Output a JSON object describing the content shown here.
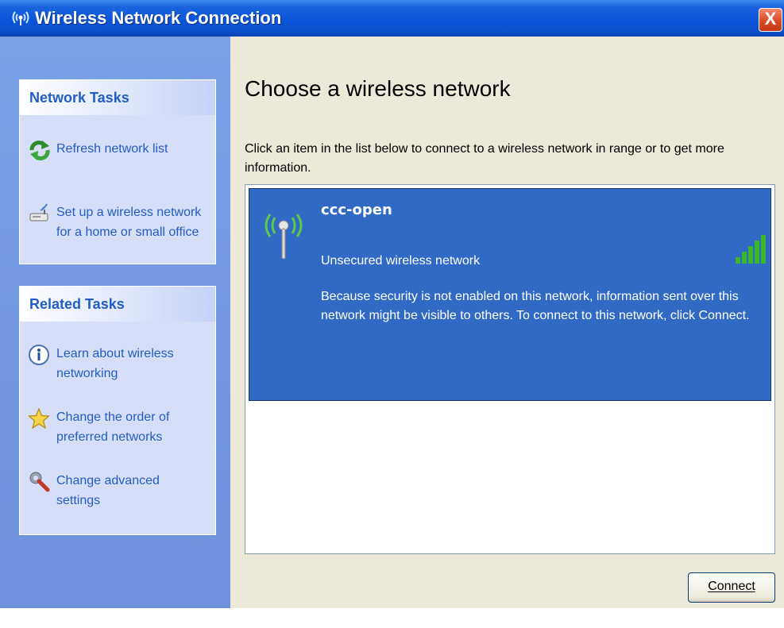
{
  "window": {
    "title": "Wireless Network Connection",
    "close_label": "X"
  },
  "sidebar": {
    "network_tasks": {
      "title": "Network Tasks",
      "items": [
        {
          "label": "Refresh network list",
          "icon": "refresh-icon"
        },
        {
          "label": "Set up a wireless network for a home or small office",
          "icon": "setup-wireless-icon"
        }
      ]
    },
    "related_tasks": {
      "title": "Related Tasks",
      "items": [
        {
          "label": "Learn about wireless networking",
          "icon": "info-icon"
        },
        {
          "label": "Change the order of preferred networks",
          "icon": "star-icon"
        },
        {
          "label": "Change advanced settings",
          "icon": "wrench-icon"
        }
      ]
    }
  },
  "main": {
    "heading": "Choose a wireless network",
    "instruction": "Click an item in the list below to connect to a wireless network in range or to get more information.",
    "networks": [
      {
        "ssid": "ccc-open",
        "status": "Unsecured wireless network",
        "description": "Because security is not enabled on this network, information sent over this network might be visible to others. To connect to this network, click Connect.",
        "signal_bars": 5,
        "signal_max": 5,
        "selected": true
      }
    ],
    "connect_label": "Connect"
  },
  "colors": {
    "titlebar": "#0a55da",
    "sidebar": "#7aa1e6",
    "link": "#215dc6",
    "selection": "#316ac5",
    "signal": "#3bb82c"
  }
}
